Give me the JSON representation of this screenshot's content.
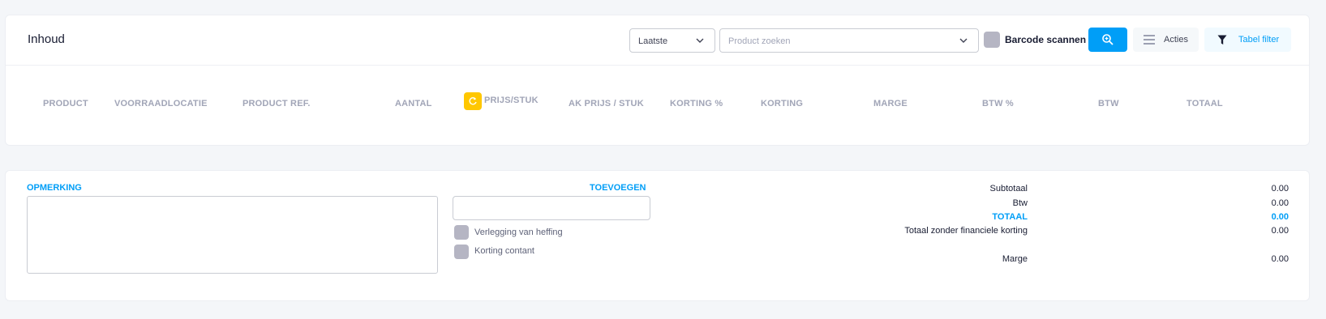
{
  "header": {
    "title": "Inhoud",
    "sort_select": "Laatste",
    "product_search_placeholder": "Product zoeken",
    "barcode_label": "Barcode scannen",
    "actions_label": "Acties",
    "table_filter_label": "Tabel filter"
  },
  "table": {
    "columns": [
      "PRODUCT",
      "VOORRAADLOCATIE",
      "PRODUCT REF.",
      "AANTAL",
      "PRIJS/STUK",
      "AK PRIJS / STUK",
      "KORTING %",
      "KORTING",
      "MARGE",
      "BTW %",
      "BTW",
      "TOTAAL"
    ]
  },
  "footer": {
    "remark_label": "OPMERKING",
    "add_label": "TOEVOEGEN",
    "reverse_charge_label": "Verlegging van heffing",
    "cash_discount_label": "Korting contant",
    "summary": {
      "subtotal_label": "Subtotaal",
      "subtotal_value": "0.00",
      "vat_label": "Btw",
      "vat_value": "0.00",
      "total_label": "TOTAAL",
      "total_value": "0.00",
      "total_without_discount_label": "Totaal zonder financiele korting",
      "total_without_discount_value": "0.00",
      "margin_label": "Marge",
      "margin_value": "0.00"
    }
  },
  "colors": {
    "primary": "#009ef7",
    "warning": "#ffc700",
    "checkbox": "#b5b5c3",
    "muted_text": "#a1a5b7"
  }
}
